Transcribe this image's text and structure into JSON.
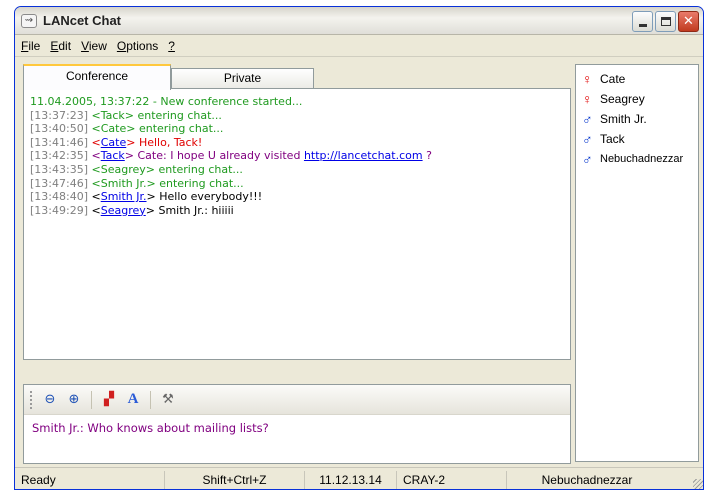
{
  "window": {
    "title": "LANcet Chat",
    "close_glyph": "✕",
    "title_icon_glyph": "⇝"
  },
  "menu": [
    {
      "label": "File",
      "mnemonic": "F",
      "rest": "ile"
    },
    {
      "label": "Edit",
      "mnemonic": "E",
      "rest": "dit"
    },
    {
      "label": "View",
      "mnemonic": "V",
      "rest": "iew"
    },
    {
      "label": "Options",
      "mnemonic": "O",
      "rest": "ptions"
    },
    {
      "label": "?",
      "mnemonic": "?",
      "rest": ""
    }
  ],
  "tabs": {
    "conference": "Conference",
    "private": "Private"
  },
  "chat": {
    "lines": [
      {
        "first": "11.04.2005, 13:37:22 - New conference started..."
      },
      {
        "ts": "[13:37:23]",
        "open": " <",
        "nick": "Tack",
        "close": "> ",
        "msg": "entering chat..."
      },
      {
        "ts": "[13:40:50]",
        "open": " <",
        "nick": "Cate",
        "close": "> ",
        "msg": "entering chat..."
      },
      {
        "ts": "[13:41:46]",
        "open": " <",
        "nick": "Cate",
        "close": "> ",
        "msg": "Hello, Tack!"
      },
      {
        "ts": "[13:42:35]",
        "open": " <",
        "nick": "Tack",
        "close": "> ",
        "msg": "Cate: I hope U already visited ",
        "url": "http://lancetchat.com",
        "after": " ?"
      },
      {
        "ts": "[13:43:35]",
        "open": " <",
        "nick": "Seagrey",
        "close": "> ",
        "msg": "entering chat..."
      },
      {
        "ts": "[13:47:46]",
        "open": " <",
        "nick": "Smith Jr.",
        "close": "> ",
        "msg": "entering chat..."
      },
      {
        "ts": "[13:48:40]",
        "open": " <",
        "nick": "Smith Jr.",
        "close": "> ",
        "msg": "Hello everybody!!!"
      },
      {
        "ts": "[13:49:29]",
        "open": " <",
        "nick": "Seagrey",
        "close": "> ",
        "msg": "Smith Jr.: hiiiii"
      }
    ]
  },
  "toolbar": {
    "zoom_out_icon": "⊖",
    "zoom_in_icon": "⊕",
    "color_icon": "▞",
    "font_icon": "A",
    "tools_icon": "⚒"
  },
  "compose": {
    "text": "Smith Jr.: Who knows about mailing lists?"
  },
  "users": [
    {
      "name": "Cate",
      "gender": "♀"
    },
    {
      "name": "Seagrey",
      "gender": "♀"
    },
    {
      "name": "Smith Jr.",
      "gender": "♂"
    },
    {
      "name": "Tack",
      "gender": "♂"
    },
    {
      "name": "Nebuchadnezzar",
      "gender": "♂"
    }
  ],
  "status": {
    "state": "Ready",
    "hotkey": "Shift+Ctrl+Z",
    "ip": "11.12.13.14",
    "host": "CRAY-2",
    "user": "Nebuchadnezzar"
  },
  "colors": {
    "system_green": "#1f9a1f",
    "timestamp_gray": "#808080",
    "own_purple": "#800080",
    "alert_red": "#e00000",
    "link_blue": "#0000e6"
  }
}
